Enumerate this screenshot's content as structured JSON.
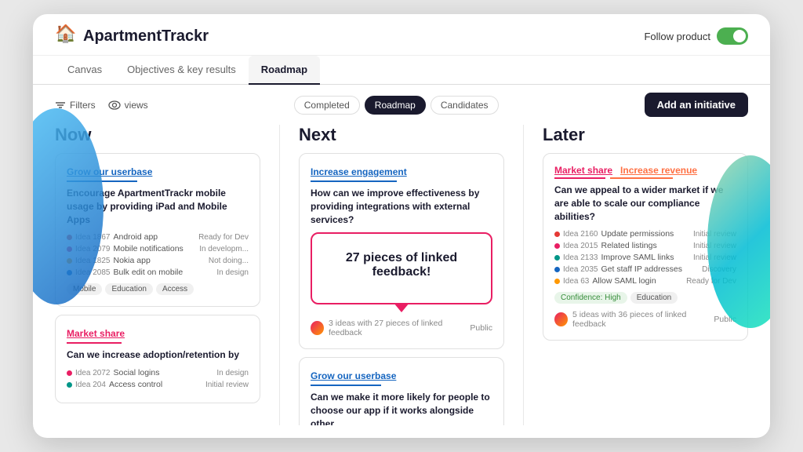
{
  "app": {
    "name": "ApartmentTrackr",
    "logo": "🏠"
  },
  "header": {
    "follow_label": "Follow product",
    "toggle_on": true
  },
  "nav": {
    "tabs": [
      {
        "label": "Canvas",
        "active": false
      },
      {
        "label": "Objectives & key results",
        "active": false
      },
      {
        "label": "Roadmap",
        "active": true
      }
    ]
  },
  "toolbar": {
    "filter_label": "Filters",
    "views_label": "views",
    "filter_pills": [
      {
        "label": "Completed",
        "active": false
      },
      {
        "label": "Roadmap",
        "active": true
      },
      {
        "label": "Candidates",
        "active": false
      }
    ],
    "add_initiative_label": "Add an initiative"
  },
  "columns": {
    "now": {
      "title": "Now",
      "cards": [
        {
          "id": "card-grow-userbase",
          "title": "Grow our userbase",
          "title_color": "blue",
          "desc": "Encourage ApartmentTrackr mobile usage by providing iPad and Mobile Apps",
          "ideas": [
            {
              "dot": "red",
              "id": "Idea 1867",
              "name": "Android app",
              "status": "Ready for Dev"
            },
            {
              "dot": "pink",
              "id": "Idea 2079",
              "name": "Mobile notifications",
              "status": "In developm..."
            },
            {
              "dot": "orange",
              "id": "Idea 1825",
              "name": "Nokia app",
              "status": "Not doing..."
            },
            {
              "dot": "blue",
              "id": "Idea 2085",
              "name": "Bulk edit on mobile",
              "status": "In design"
            }
          ],
          "tags": [
            "Mobile",
            "Education",
            "Access"
          ]
        },
        {
          "id": "card-market-share",
          "title": "Market share",
          "title_color": "pink",
          "desc": "Can we increase adoption/retention by",
          "ideas": [
            {
              "dot": "pink",
              "id": "Idea 2072",
              "name": "Social logins",
              "status": "In design"
            },
            {
              "dot": "teal",
              "id": "Idea 204",
              "name": "Access control",
              "status": "Initial review"
            }
          ],
          "tags": []
        }
      ]
    },
    "next": {
      "title": "Next",
      "cards": [
        {
          "id": "card-increase-engagement",
          "title": "Increase engagement",
          "title_color": "blue",
          "desc": "How can we improve effectiveness by providing integrations with external services?",
          "feedback": {
            "text": "27 pieces of linked feedback!",
            "footer_left": "3 ideas with 27 pieces of linked feedback",
            "footer_right": "Public"
          }
        },
        {
          "id": "card-grow-userbase-next",
          "title": "Grow our userbase",
          "title_color": "blue",
          "desc": "Can we make it more likely for people to choose our app if it works alongside other"
        }
      ]
    },
    "later": {
      "title": "Later",
      "cards": [
        {
          "id": "card-later-multi",
          "titles": [
            {
              "label": "Market share",
              "color": "pink"
            },
            {
              "label": "Increase revenue",
              "color": "orange"
            }
          ],
          "desc": "Can we appeal to a wider market if we are able to scale our compliance abilities?",
          "ideas": [
            {
              "dot": "red",
              "id": "Idea 2160",
              "name": "Update permissions",
              "status": "Initial review"
            },
            {
              "dot": "pink",
              "id": "Idea 2015",
              "name": "Related listings",
              "status": "Initial review"
            },
            {
              "dot": "teal",
              "id": "Idea 2133",
              "name": "Improve SAML links",
              "status": "Initial review"
            },
            {
              "dot": "blue",
              "id": "Idea 2035",
              "name": "Get staff IP addresses",
              "status": "Discovery"
            },
            {
              "dot": "orange",
              "id": "Idea 63",
              "name": "Allow SAML login",
              "status": "Ready for Dev"
            }
          ],
          "tags": [
            "Confidence: High",
            "Education"
          ],
          "footer_left": "5 ideas with 36 pieces of linked feedback",
          "footer_right": "Public"
        }
      ]
    }
  }
}
